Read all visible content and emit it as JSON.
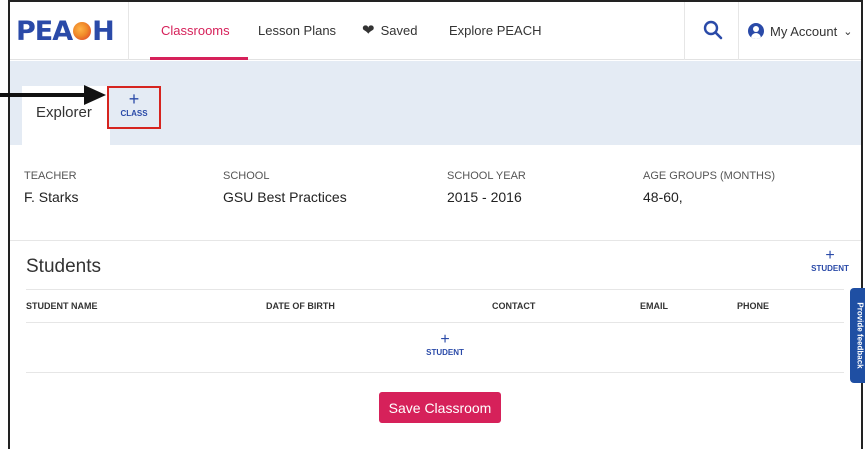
{
  "brand": {
    "name": "PEACH",
    "logo_left": "PEA",
    "logo_right": "H",
    "accent": "#d6215a",
    "primary": "#2a4aa8"
  },
  "nav": {
    "items": [
      {
        "label": "Classrooms",
        "active": true
      },
      {
        "label": "Lesson Plans"
      },
      {
        "label": "Saved",
        "icon": "heart-icon"
      },
      {
        "label": "Explore PEACH"
      }
    ],
    "search_icon": "search-icon",
    "account_label": "My Account"
  },
  "tabs": {
    "explorer": "Explorer",
    "add_class_plus": "+",
    "add_class_label": "CLASS"
  },
  "classroom": {
    "teacher_label": "TEACHER",
    "teacher_value": "F. Starks",
    "school_label": "SCHOOL",
    "school_value": "GSU Best Practices",
    "year_label": "SCHOOL YEAR",
    "year_value": "2015 - 2016",
    "age_label": "AGE GROUPS (MONTHS)",
    "age_value": "48-60,"
  },
  "students": {
    "title": "Students",
    "add_plus": "+",
    "add_label": "STUDENT",
    "columns": [
      "STUDENT NAME",
      "DATE OF BIRTH",
      "CONTACT",
      "EMAIL",
      "PHONE"
    ]
  },
  "save_button": "Save Classroom",
  "feedback_tab": "Provide feedback"
}
